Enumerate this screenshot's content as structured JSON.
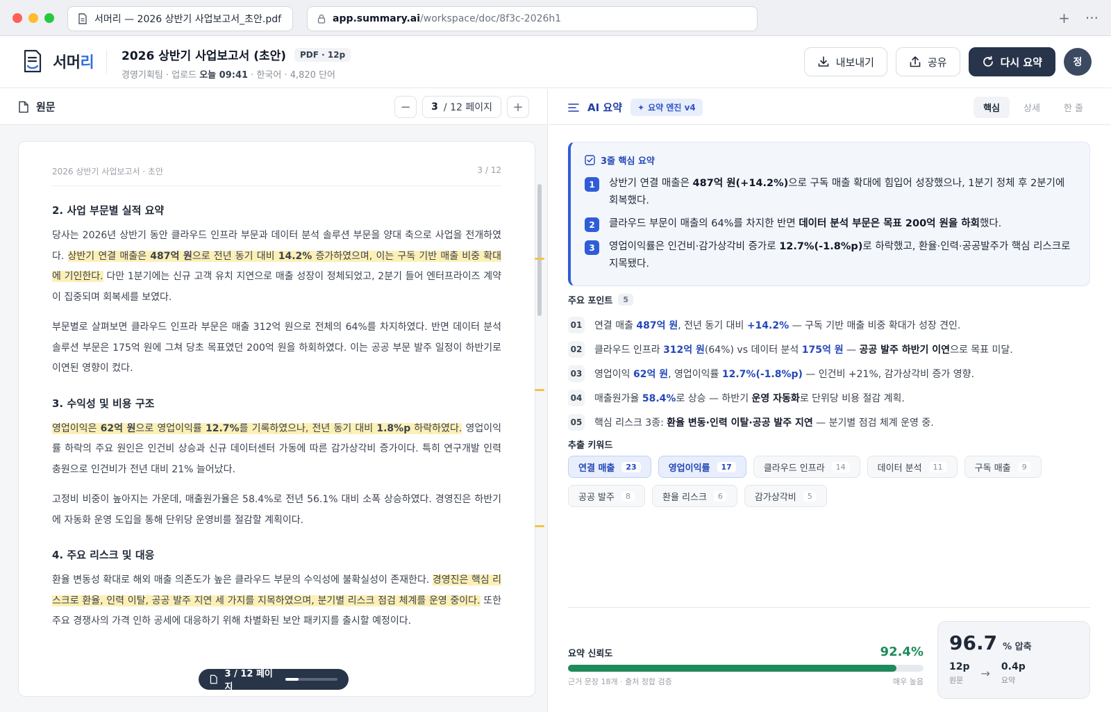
{
  "browser": {
    "tab_title": "서머리 — 2026 상반기 사업보고서_초안.pdf",
    "url_host": "app.summary.ai",
    "url_path": "/workspace/doc/8f3c-2026h1",
    "new_tab_glyph": "+",
    "more_glyph": "···"
  },
  "header": {
    "logo_main": "서머",
    "logo_accent": "리",
    "doc_title": "2026 상반기 사업보고서 (초안)",
    "doc_badge": "PDF · 12p",
    "meta_prefix": "경영기획팀 · 업로드 ",
    "meta_time": "오늘 09:41",
    "meta_suffix": " · 한국어 · 4,820 단어",
    "export_label": "내보내기",
    "share_label": "공유",
    "resummarize_label": "다시 요약",
    "avatar_initial": "정"
  },
  "left": {
    "title": "원문",
    "page_current": "3",
    "page_total": "/ 12 페이지",
    "page_header_left": "2026 상반기 사업보고서 · 초안",
    "page_header_right": "3 / 12",
    "sections": [
      {
        "heading": "2. 사업 부문별 실적 요약",
        "paragraphs": [
          [
            {
              "t": "당사는 2026년 상반기 동안 클라우드 인프라 부문과 데이터 분석 솔루션 부문을 양대 축으로 사업을 전개하였다. "
            },
            {
              "t": "상반기 연결 매출은 ",
              "h": true
            },
            {
              "t": "487억 원",
              "h": true,
              "b": true
            },
            {
              "t": "으로 전년 동기 대비 ",
              "h": true
            },
            {
              "t": "14.2%",
              "h": true,
              "b": true
            },
            {
              "t": " 증가하였으며, 이는 구독 기반 매출 비중 확대에 기인한다.",
              "h": true
            },
            {
              "t": " 다만 1분기에는 신규 고객 유치 지연으로 매출 성장이 정체되었고, 2분기 들어 엔터프라이즈 계약이 집중되며 회복세를 보였다."
            }
          ],
          [
            {
              "t": "부문별로 살펴보면 클라우드 인프라 부문은 매출 312억 원으로 전체의 64%를 차지하였다. 반면 데이터 분석 솔루션 부문은 175억 원에 그쳐 당초 목표였던 200억 원을 하회하였다. 이는 공공 부문 발주 일정이 하반기로 이연된 영향이 컸다."
            }
          ]
        ]
      },
      {
        "heading": "3. 수익성 및 비용 구조",
        "paragraphs": [
          [
            {
              "t": "영업이익은 ",
              "h": true
            },
            {
              "t": "62억 원",
              "h": true,
              "b": true
            },
            {
              "t": "으로 영업이익률 ",
              "h": true
            },
            {
              "t": "12.7%",
              "h": true,
              "b": true
            },
            {
              "t": "를 기록하였으나, 전년 동기 대비 ",
              "h": true
            },
            {
              "t": "1.8%p",
              "h": true,
              "b": true
            },
            {
              "t": " 하락하였다.",
              "h": true
            },
            {
              "t": " 영업이익률 하락의 주요 원인은 인건비 상승과 신규 데이터센터 가동에 따른 감가상각비 증가이다. 특히 연구개발 인력 충원으로 인건비가 전년 대비 21% 늘어났다."
            }
          ],
          [
            {
              "t": "고정비 비중이 높아지는 가운데, 매출원가율은 58.4%로 전년 56.1% 대비 소폭 상승하였다. 경영진은 하반기에 자동화 운영 도입을 통해 단위당 운영비를 절감할 계획이다."
            }
          ]
        ]
      },
      {
        "heading": "4. 주요 리스크 및 대응",
        "paragraphs": [
          [
            {
              "t": "환율 변동성 확대로 해외 매출 의존도가 높은 클라우드 부문의 수익성에 불확실성이 존재한다. "
            },
            {
              "t": "경영진은 핵심 리스크로 환율, 인력 이탈, 공공 발주 지연 세 가지를 지목하였으며, 분기별 리스크 점검 체계를 운영 중이다.",
              "h": true
            },
            {
              "t": " 또한 주요 경쟁사의 가격 인하 공세에 대응하기 위해 차별화된 보안 패키지를 출시할 예정이다."
            }
          ]
        ]
      }
    ],
    "floating_pager_label": "3 / 12 페이지",
    "reading_progress": 0.25
  },
  "right": {
    "title": "AI 요약",
    "engine_badge": "요약 엔진 v4",
    "modes": [
      {
        "label": "핵심",
        "active": true
      },
      {
        "label": "상세",
        "active": false
      },
      {
        "label": "한 줄",
        "active": false
      }
    ],
    "core_title": "3줄 핵심 요약",
    "core_items": [
      {
        "n": "1",
        "parts": [
          {
            "t": "상반기 연결 매출은 "
          },
          {
            "t": "487억 원(+14.2%)",
            "k": true
          },
          {
            "t": "으로 구독 매출 확대에 힘입어 성장했으나, 1분기 정체 후 2분기에 회복했다."
          }
        ]
      },
      {
        "n": "2",
        "parts": [
          {
            "t": "클라우드 부문이 매출의 64%를 차지한 반면 "
          },
          {
            "t": "데이터 분석 부문은 목표 200억 원을 하회",
            "k": true
          },
          {
            "t": "했다."
          }
        ]
      },
      {
        "n": "3",
        "parts": [
          {
            "t": "영업이익률은 인건비·감가상각비 증가로 "
          },
          {
            "t": "12.7%(-1.8%p)",
            "k": true
          },
          {
            "t": "로 하락했고, 환율·인력·공공발주가 핵심 리스크로 지목됐다."
          }
        ]
      }
    ],
    "points_title": "주요 포인트",
    "points_count": "5",
    "points": [
      {
        "n": "01",
        "parts": [
          {
            "t": "연결 매출 "
          },
          {
            "t": "487억 원",
            "c": "b"
          },
          {
            "t": ", 전년 동기 대비 "
          },
          {
            "t": "+14.2%",
            "c": "b"
          },
          {
            "t": " — 구독 기반 매출 비중 확대가 성장 견인."
          }
        ]
      },
      {
        "n": "02",
        "parts": [
          {
            "t": "클라우드 인프라 "
          },
          {
            "t": "312억 원",
            "c": "b"
          },
          {
            "t": "(64%) vs 데이터 분석 "
          },
          {
            "t": "175억 원",
            "c": "b"
          },
          {
            "t": " — "
          },
          {
            "t": "공공 발주 하반기 이연",
            "c": "k"
          },
          {
            "t": "으로 목표 미달."
          }
        ]
      },
      {
        "n": "03",
        "parts": [
          {
            "t": "영업이익 "
          },
          {
            "t": "62억 원",
            "c": "b"
          },
          {
            "t": ", 영업이익률 "
          },
          {
            "t": "12.7%(-1.8%p)",
            "c": "b"
          },
          {
            "t": " — 인건비 +21%, 감가상각비 증가 영향."
          }
        ]
      },
      {
        "n": "04",
        "parts": [
          {
            "t": "매출원가율 "
          },
          {
            "t": "58.4%",
            "c": "b"
          },
          {
            "t": "로 상승 — 하반기 "
          },
          {
            "t": "운영 자동화",
            "c": "k"
          },
          {
            "t": "로 단위당 비용 절감 계획."
          }
        ]
      },
      {
        "n": "05",
        "parts": [
          {
            "t": "핵심 리스크 3종: "
          },
          {
            "t": "환율 변동·인력 이탈·공공 발주 지연",
            "c": "k"
          },
          {
            "t": " — 분기별 점검 체계 운영 중."
          }
        ]
      }
    ],
    "keywords_title": "추출 키워드",
    "keywords": [
      {
        "label": "연결 매출",
        "count": "23",
        "primary": true
      },
      {
        "label": "영업이익률",
        "count": "17",
        "primary": true
      },
      {
        "label": "클라우드 인프라",
        "count": "14",
        "primary": false
      },
      {
        "label": "데이터 분석",
        "count": "11",
        "primary": false
      },
      {
        "label": "구독 매출",
        "count": "9",
        "primary": false
      },
      {
        "label": "공공 발주",
        "count": "8",
        "primary": false
      },
      {
        "label": "환율 리스크",
        "count": "6",
        "primary": false
      },
      {
        "label": "감가상각비",
        "count": "5",
        "primary": false
      }
    ],
    "trust_label": "요약 신뢰도",
    "trust_value_text": "92.4%",
    "trust_value": 0.924,
    "trust_sub_left": "근거 문장 18개 · 출처 정합 검증",
    "trust_sub_right": "매우 높음",
    "compress_value": "96.7",
    "compress_unit": "% 압축",
    "compress_from": "12p",
    "compress_from_label": "원문",
    "compress_to": "0.4p",
    "compress_to_label": "요약"
  },
  "colors": {
    "accent": "#2f5dd8",
    "dark_button": "#273449",
    "highlight": "#fdf0b6",
    "trust_green": "#1f8a5a"
  }
}
